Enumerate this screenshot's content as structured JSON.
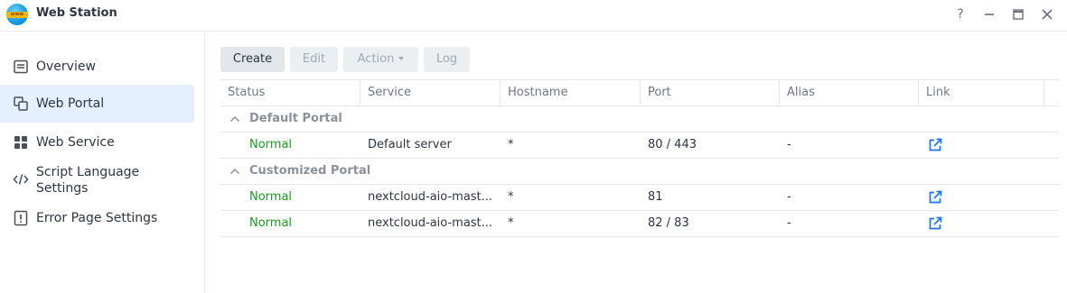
{
  "window": {
    "title": "Web Station",
    "app_icon_text": "www",
    "controls": [
      "help-icon",
      "minimize-icon",
      "maximize-icon",
      "close-icon"
    ]
  },
  "sidebar": {
    "items": [
      {
        "label": "Overview",
        "icon": "overview-icon",
        "active": false
      },
      {
        "label": "Web Portal",
        "icon": "web-portal-icon",
        "active": true
      },
      {
        "label": "Web Service",
        "icon": "web-service-icon",
        "active": false
      },
      {
        "label": "Script Language Settings",
        "line1": "Script Language",
        "line2": "Settings",
        "icon": "code-icon",
        "active": false
      },
      {
        "label": "Error Page Settings",
        "icon": "error-page-icon",
        "active": false
      }
    ]
  },
  "toolbar": {
    "create": "Create",
    "edit": "Edit",
    "action": "Action",
    "log": "Log"
  },
  "table": {
    "columns": [
      "Status",
      "Service",
      "Hostname",
      "Port",
      "Alias",
      "Link"
    ],
    "groups": [
      {
        "name": "Default Portal",
        "rows": [
          {
            "status": "Normal",
            "service": "Default server",
            "hostname": "*",
            "port": "80 / 443",
            "alias": "-",
            "link": "external-link-icon"
          }
        ]
      },
      {
        "name": "Customized Portal",
        "rows": [
          {
            "status": "Normal",
            "service": "nextcloud-aio-mast...",
            "hostname": "*",
            "port": "81",
            "alias": "-",
            "link": "external-link-icon"
          },
          {
            "status": "Normal",
            "service": "nextcloud-aio-mast...",
            "hostname": "*",
            "port": "82 / 83",
            "alias": "-",
            "link": "external-link-icon"
          }
        ]
      }
    ]
  },
  "colors": {
    "accent": "#1a73e8",
    "status_normal": "#1a9a22",
    "active_bg": "#e4efff"
  }
}
